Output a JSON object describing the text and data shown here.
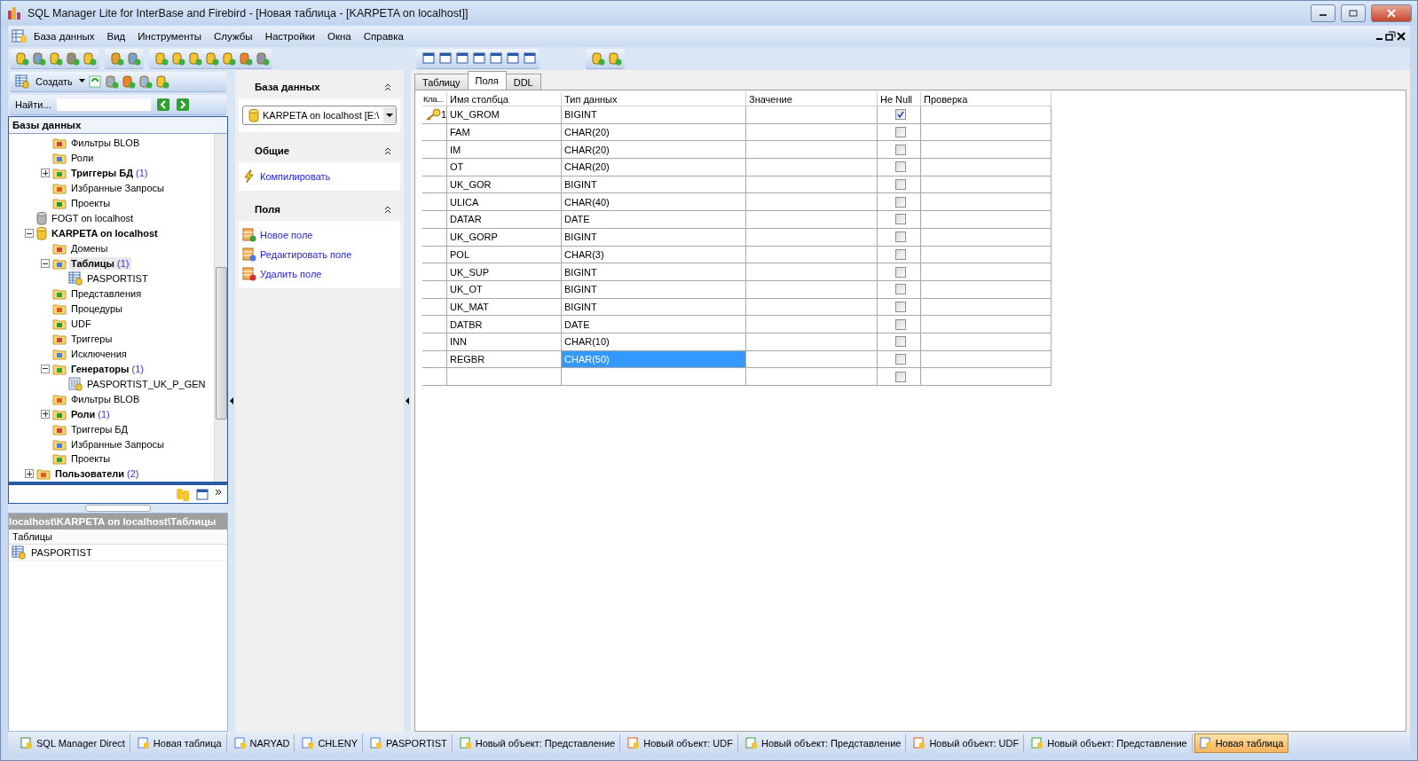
{
  "window": {
    "title": "SQL Manager Lite for InterBase and Firebird - [Новая таблица - [KARPETA on localhost]]"
  },
  "menu": [
    "База данных",
    "Вид",
    "Инструменты",
    "Службы",
    "Настройки",
    "Окна",
    "Справка"
  ],
  "explorer": {
    "create_button": "Создать",
    "find_label": "Найти...",
    "title": "Базы данных",
    "tree": [
      {
        "kind": "group",
        "children": [
          {
            "kind": "folder",
            "label": "Фильтры BLOB",
            "selected": false
          },
          {
            "kind": "folder",
            "label": "Роли",
            "selected": false
          },
          {
            "kind": "folder",
            "label": "Триггеры БД",
            "count": "(1)",
            "expanded": false,
            "selected": false
          },
          {
            "kind": "folder",
            "label": "Избранные Запросы",
            "selected": false
          },
          {
            "kind": "folder",
            "label": "Проекты",
            "selected": false
          }
        ]
      },
      {
        "kind": "database",
        "label": "FOGT on localhost",
        "connected": false,
        "selected": false
      },
      {
        "kind": "database",
        "label": "KARPETA on localhost",
        "connected": true,
        "expanded": true,
        "selected": false,
        "children": [
          {
            "kind": "folder",
            "label": "Домены",
            "selected": false
          },
          {
            "kind": "folder",
            "label": "Таблицы",
            "count": "(1)",
            "expanded": true,
            "selected": true,
            "children": [
              {
                "kind": "table",
                "label": "PASPORTIST",
                "selected": false
              }
            ]
          },
          {
            "kind": "folder",
            "label": "Представления",
            "selected": false
          },
          {
            "kind": "folder",
            "label": "Процедуры",
            "selected": false
          },
          {
            "kind": "folder",
            "label": "UDF",
            "selected": false
          },
          {
            "kind": "folder",
            "label": "Триггеры",
            "selected": false
          },
          {
            "kind": "folder",
            "label": "Исключения",
            "selected": false
          },
          {
            "kind": "folder",
            "label": "Генераторы",
            "count": "(1)",
            "expanded": true,
            "selected": false,
            "children": [
              {
                "kind": "generator",
                "label": "PASPORTIST_UK_P_GEN",
                "selected": false
              }
            ]
          },
          {
            "kind": "folder",
            "label": "Фильтры BLOB",
            "selected": false
          },
          {
            "kind": "folder",
            "label": "Роли",
            "count": "(1)",
            "expanded": false,
            "selected": false
          },
          {
            "kind": "folder",
            "label": "Триггеры БД",
            "selected": false
          },
          {
            "kind": "folder",
            "label": "Избранные Запросы",
            "selected": false
          },
          {
            "kind": "folder",
            "label": "Проекты",
            "selected": false
          }
        ]
      },
      {
        "kind": "folder",
        "label": "Пользователи",
        "count": "(2)",
        "expanded": false,
        "selected": false
      }
    ]
  },
  "object_list": {
    "path": "localhost\\KARPETA on localhost\\Таблицы",
    "column": "Таблицы",
    "rows": [
      "PASPORTIST"
    ]
  },
  "navbar": {
    "sections": [
      {
        "title": "База данных",
        "kind": "select",
        "value": "KARPETA on localhost [E:\\"
      },
      {
        "title": "Общие",
        "kind": "links",
        "links": [
          "Компилировать"
        ]
      },
      {
        "title": "Поля",
        "kind": "links",
        "links": [
          "Новое поле",
          "Редактировать поле",
          "Удалить поле"
        ]
      }
    ]
  },
  "tabs": [
    {
      "label": "Таблицу",
      "selected": false
    },
    {
      "label": "Поля",
      "selected": true
    },
    {
      "label": "DDL",
      "selected": false
    }
  ],
  "table": {
    "columns": [
      "Кла...",
      "Имя столбца",
      "Тип данных",
      "Значение",
      "Не Null",
      "Проверка"
    ],
    "rows": [
      {
        "key": "1",
        "name": "UK_GROM",
        "type": "BIGINT",
        "not_null": true,
        "selected": false
      },
      {
        "name": "FAM",
        "type": "CHAR(20)",
        "not_null": false,
        "selected": false
      },
      {
        "name": "IM",
        "type": "CHAR(20)",
        "not_null": false,
        "selected": false
      },
      {
        "name": "OT",
        "type": "CHAR(20)",
        "not_null": false,
        "selected": false
      },
      {
        "name": "UK_GOR",
        "type": "BIGINT",
        "not_null": false,
        "selected": false
      },
      {
        "name": "ULICA",
        "type": "CHAR(40)",
        "not_null": false,
        "selected": false
      },
      {
        "name": "DATAR",
        "type": "DATE",
        "not_null": false,
        "selected": false
      },
      {
        "name": "UK_GORP",
        "type": "BIGINT",
        "not_null": false,
        "selected": false
      },
      {
        "name": "POL",
        "type": "CHAR(3)",
        "not_null": false,
        "selected": false
      },
      {
        "name": "UK_SUP",
        "type": "BIGINT",
        "not_null": false,
        "selected": false
      },
      {
        "name": "UK_OT",
        "type": "BIGINT",
        "not_null": false,
        "selected": false
      },
      {
        "name": "UK_MAT",
        "type": "BIGINT",
        "not_null": false,
        "selected": false
      },
      {
        "name": "DATBR",
        "type": "DATE",
        "not_null": false,
        "selected": false
      },
      {
        "name": "INN",
        "type": "CHAR(10)",
        "not_null": false,
        "selected": false
      },
      {
        "name": "REGBR",
        "type": "CHAR(50)",
        "not_null": false,
        "selected": true
      },
      {
        "not_null": false,
        "selected": false
      }
    ]
  },
  "taskbar": [
    {
      "label": "SQL Manager Direct",
      "kind": "direct",
      "selected": false
    },
    {
      "label": "Новая таблица",
      "kind": "table",
      "selected": false
    },
    {
      "label": "NARYAD",
      "kind": "table",
      "selected": false
    },
    {
      "label": "CHLENY",
      "kind": "table",
      "selected": false
    },
    {
      "label": "PASPORTIST",
      "kind": "table",
      "selected": false
    },
    {
      "label": "Новый объект: Представление",
      "kind": "view",
      "selected": false
    },
    {
      "label": "Новый объект: UDF",
      "kind": "udf",
      "selected": false
    },
    {
      "label": "Новый объект: Представление",
      "kind": "view",
      "selected": false
    },
    {
      "label": "Новый объект: UDF",
      "kind": "udf",
      "selected": false
    },
    {
      "label": "Новый объект: Представление",
      "kind": "view",
      "selected": false
    },
    {
      "label": "Новая таблица",
      "kind": "table",
      "selected": true
    }
  ]
}
